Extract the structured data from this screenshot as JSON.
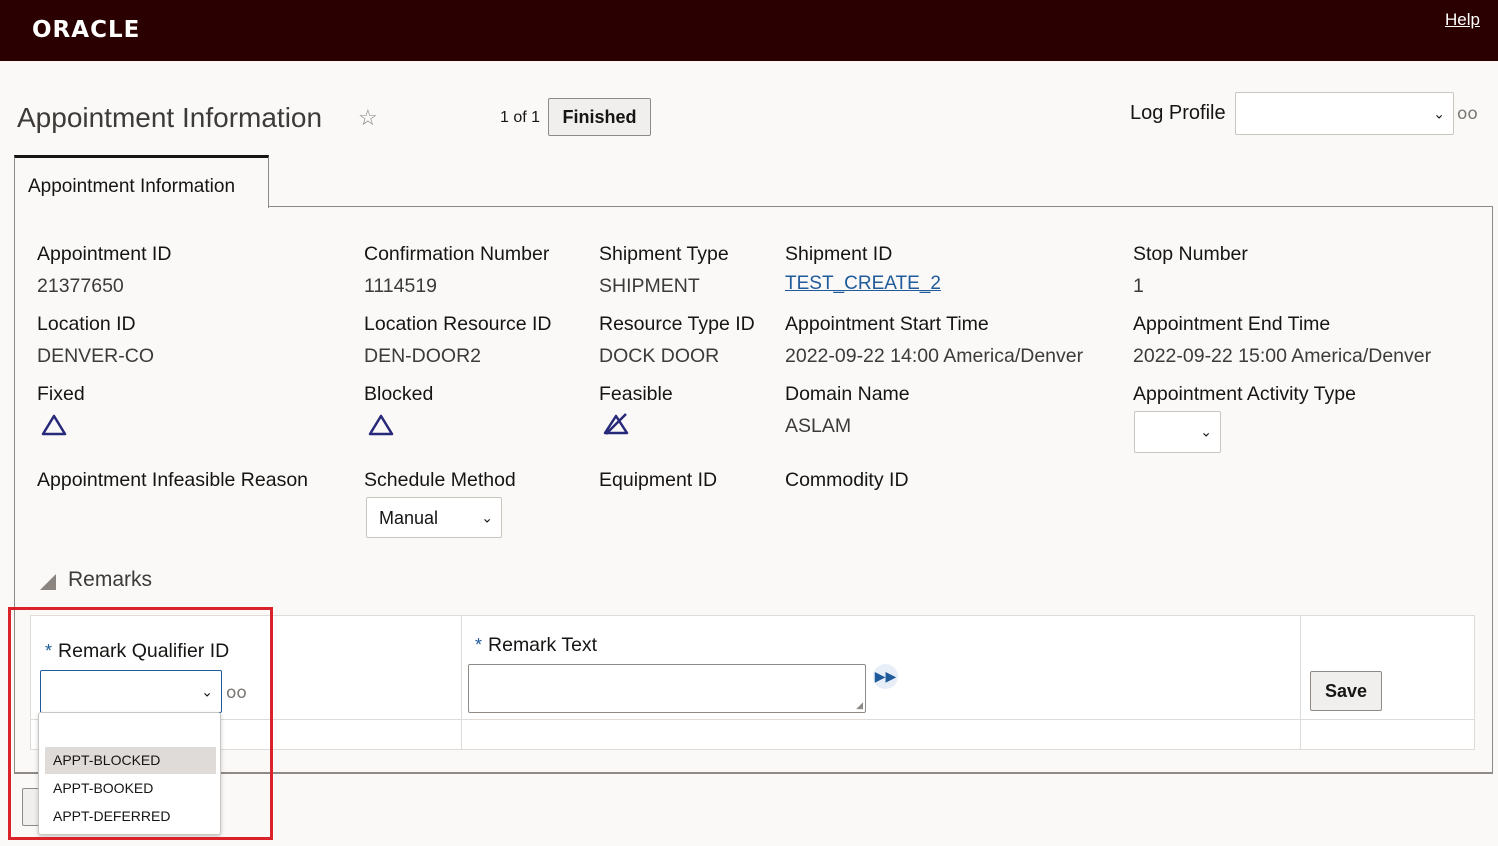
{
  "header": {
    "logo": "ORACLE",
    "help": "Help"
  },
  "page": {
    "title": "Appointment Information",
    "counter": "1 of 1",
    "finished": "Finished",
    "log_profile_label": "Log Profile"
  },
  "tab": {
    "label": "Appointment Information"
  },
  "fields": {
    "appointment_id": {
      "label": "Appointment ID",
      "value": "21377650"
    },
    "confirmation_number": {
      "label": "Confirmation Number",
      "value": "1114519"
    },
    "shipment_type": {
      "label": "Shipment Type",
      "value": "SHIPMENT"
    },
    "shipment_id": {
      "label": "Shipment ID",
      "value": "TEST_CREATE_2"
    },
    "stop_number": {
      "label": "Stop Number",
      "value": "1"
    },
    "location_id": {
      "label": "Location ID",
      "value": "DENVER-CO"
    },
    "location_resource_id": {
      "label": "Location Resource ID",
      "value": "DEN-DOOR2"
    },
    "resource_type_id": {
      "label": "Resource Type ID",
      "value": "DOCK DOOR"
    },
    "start_time": {
      "label": "Appointment Start Time",
      "value": "2022-09-22 14:00 America/Denver"
    },
    "end_time": {
      "label": "Appointment End Time",
      "value": "2022-09-22 15:00 America/Denver"
    },
    "fixed": {
      "label": "Fixed"
    },
    "blocked": {
      "label": "Blocked"
    },
    "feasible": {
      "label": "Feasible"
    },
    "domain_name": {
      "label": "Domain Name",
      "value": "ASLAM"
    },
    "activity_type": {
      "label": "Appointment Activity Type",
      "value": ""
    },
    "infeasible_reason": {
      "label": "Appointment Infeasible Reason"
    },
    "schedule_method": {
      "label": "Schedule Method",
      "value": "Manual"
    },
    "equipment_id": {
      "label": "Equipment ID"
    },
    "commodity_id": {
      "label": "Commodity ID"
    }
  },
  "remarks": {
    "title": "Remarks",
    "required_mark": "*",
    "qualifier_label": "Remark Qualifier ID",
    "text_label": "Remark Text",
    "save": "Save",
    "options": [
      "APPT-BLOCKED",
      "APPT-BOOKED",
      "APPT-DEFERRED"
    ]
  },
  "colors": {
    "header_bg": "#2a0000",
    "link": "#1f5a9a",
    "highlight": "#d9222a"
  }
}
